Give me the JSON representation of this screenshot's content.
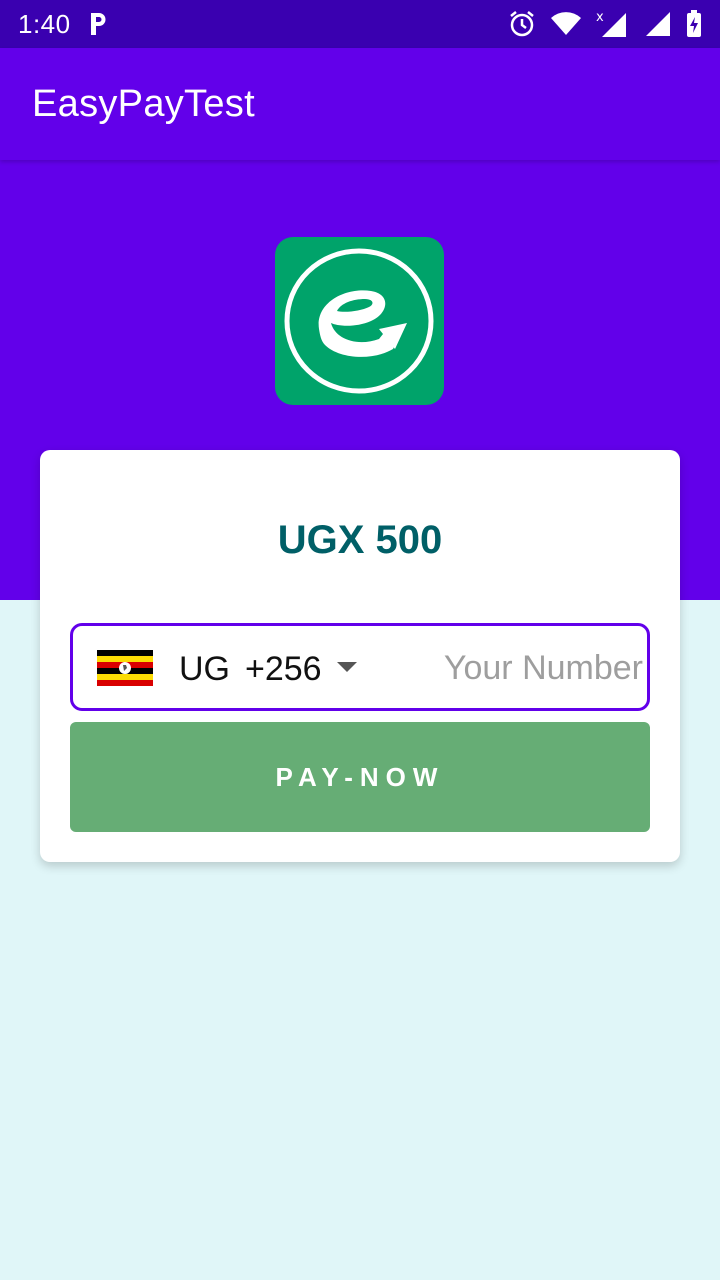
{
  "status_bar": {
    "time": "1:40",
    "notification_icon": "p-icon",
    "icons": [
      "alarm-icon",
      "wifi-icon",
      "signal-x-icon",
      "signal-icon",
      "battery-charging-icon"
    ]
  },
  "app_bar": {
    "title": "EasyPayTest"
  },
  "logo": {
    "icon": "easypay-logo-icon",
    "color": "#00a36a"
  },
  "payment": {
    "amount": "UGX 500",
    "country": {
      "flag_icon": "uganda-flag-icon",
      "code": "UG",
      "dial_code": "+256"
    },
    "number_placeholder": "Your Number",
    "number_value": "",
    "pay_button_label": "PAY-NOW"
  },
  "colors": {
    "status_bar": "#3a00b0",
    "primary": "#6200ea",
    "background": "#e0f6f8",
    "amount_text": "#005f67",
    "pay_button": "#66ad75"
  }
}
